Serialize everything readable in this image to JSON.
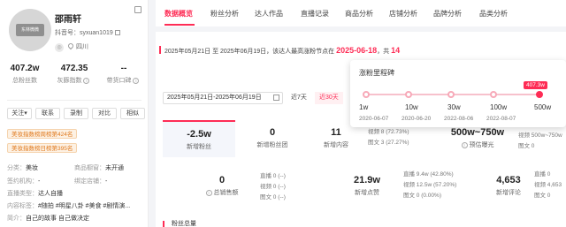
{
  "profile": {
    "avatar_text": "东林微微",
    "name": "邵雨轩",
    "douyin_label": "抖音号：syxuan1019",
    "location": "四川",
    "stats": [
      {
        "value": "407.2w",
        "label": "总粉丝数"
      },
      {
        "value": "472.35",
        "label": "灰豚指数"
      },
      {
        "value": "--",
        "label": "带货口碑"
      }
    ],
    "buttons": [
      "关注",
      "联系",
      "录制",
      "对比",
      "相似"
    ],
    "tags": [
      "美妆指数榜周榜第424名",
      "美妆指数榜日榜第395名"
    ],
    "info": {
      "category": {
        "k": "分类：",
        "v": "美妆"
      },
      "showcase": {
        "k": "商品橱窗：",
        "v": "未开通"
      },
      "org": {
        "k": "签约机构：",
        "v": "-"
      },
      "shop": {
        "k": "绑定店铺：",
        "v": "-"
      },
      "live_type": {
        "k": "直播类型：",
        "v": "达人自播"
      },
      "content": {
        "k": "内容标签：",
        "v": "#随拍 #明星八卦 #美食 #剧情演..."
      },
      "intro": {
        "k": "简介：",
        "v": "自己的故事 自己做决定"
      }
    }
  },
  "nav": {
    "tabs": [
      "数据概览",
      "粉丝分析",
      "达人作品",
      "直播记录",
      "商品分析",
      "店铺分析",
      "品牌分析",
      "品类分析"
    ],
    "active": 0
  },
  "overview": {
    "summary_prefix": "2025年05月21日 至 2025年06月19日，该达人最高涨粉节点在",
    "summary_date": "2025-06-18",
    "summary_mid": "，共",
    "summary_count": "14",
    "date_picker": "2025年05月21日-2025年06月19日",
    "ranges": [
      "近7天",
      "近30天"
    ],
    "active_range": 1,
    "metrics": [
      {
        "value": "-2.5w",
        "label": "新增粉丝"
      },
      {
        "value": "0",
        "label": "新增粉丝团"
      },
      {
        "value": "11",
        "label": "新增内容"
      },
      {
        "value": "500w~750w",
        "label": "预估曝光"
      }
    ],
    "content_sub": [
      "视频 8 (72.73%)",
      "图文 3 (27.27%)"
    ],
    "exposure_sub": [
      "直播 0",
      "视频 500w~750w",
      "图文 0"
    ],
    "sales": {
      "value": "0",
      "label": "总销售额",
      "sub": [
        "直播 0 (--)",
        "视频 0 (--)",
        "图文 0 (--)"
      ]
    },
    "likes": {
      "value": "21.9w",
      "label": "新增点赞",
      "sub": [
        "直播 9.4w (42.80%)",
        "视频 12.5w (57.20%)",
        "图文 0 (0.00%)"
      ]
    },
    "comments": {
      "value": "4,653",
      "label": "新增评论",
      "sub": [
        "直播 0",
        "视频 4,653",
        "图文 0"
      ]
    }
  },
  "milestone": {
    "title": "涨粉里程碑",
    "current": "407.3w",
    "levels": [
      "1w",
      "10w",
      "30w",
      "100w",
      "500w"
    ],
    "dates": [
      "2020-06-07",
      "2020-06-20",
      "2022-08-06",
      "2022-08-07"
    ]
  },
  "bottom_title": "粉丝总量",
  "colors": {
    "accent": "#fe2c55",
    "tag_orange": "#e07a1f"
  }
}
